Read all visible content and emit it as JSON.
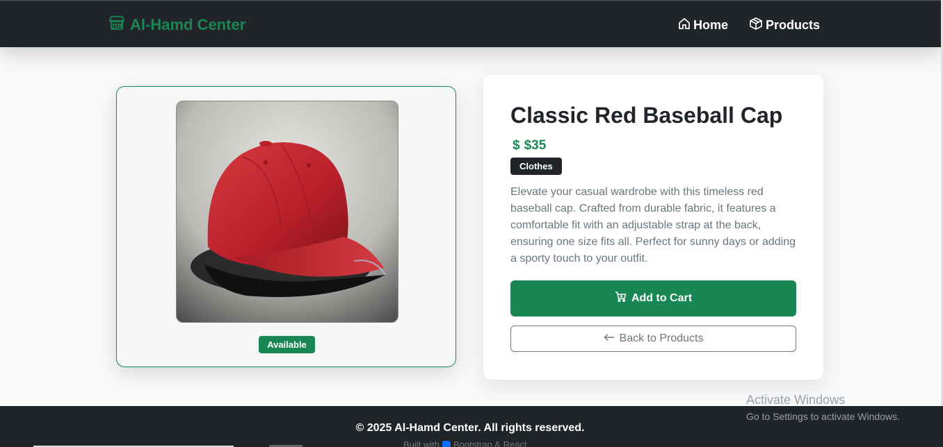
{
  "brand": {
    "name": "Al-Hamd Center",
    "color": "#198754"
  },
  "nav": {
    "home_label": "Home",
    "products_label": "Products"
  },
  "product": {
    "title": "Classic Red Baseball Cap",
    "currency_symbol": "$",
    "price": "$35",
    "category": "Clothes",
    "availability": "Available",
    "description": "Elevate your casual wardrobe with this timeless red baseball cap. Crafted from durable fabric, it features a comfortable fit with an adjustable strap at the back, ensuring one size fits all. Perfect for sunny days or adding a sporty touch to your outfit."
  },
  "actions": {
    "add_to_cart": "Add to Cart",
    "back_to_products": "Back to Products"
  },
  "footer": {
    "copyright": "© 2025 Al-Hamd Center. All rights reserved.",
    "built_prefix": "Built with",
    "built_suffix": "Bootstrap & React"
  },
  "windows_watermark": {
    "title": "Activate Windows",
    "subtitle": "Go to Settings to activate Windows."
  },
  "colors": {
    "primary": "#198754",
    "dark": "#212529",
    "muted": "#6c757d"
  }
}
